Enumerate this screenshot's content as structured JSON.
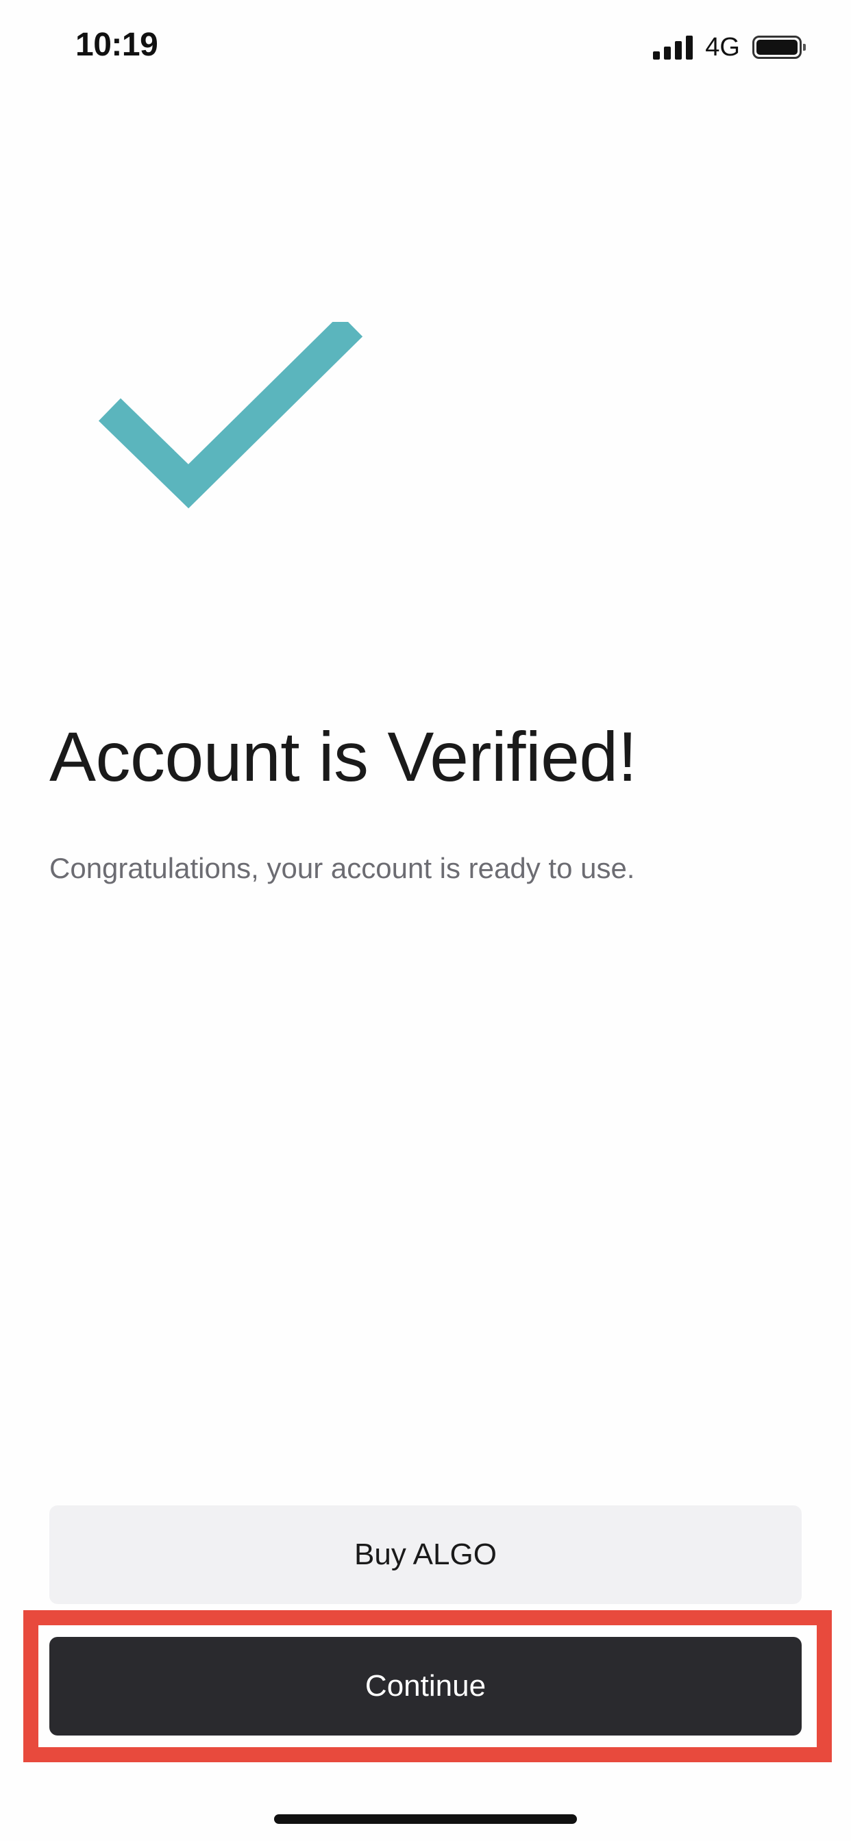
{
  "status_bar": {
    "time": "10:19",
    "network": "4G",
    "icons": [
      "signal-bars-icon",
      "battery-full-icon"
    ]
  },
  "hero": {
    "icon": "checkmark-icon",
    "icon_color": "#5bb5bd"
  },
  "content": {
    "title": "Account is Verified!",
    "subtitle": "Congratulations, your account is ready to use."
  },
  "actions": {
    "buy_label": "Buy ALGO",
    "continue_label": "Continue"
  },
  "colors": {
    "primary_button": "#2a2a2e",
    "secondary_button": "#f1f1f3",
    "highlight": "#e84a3d"
  }
}
